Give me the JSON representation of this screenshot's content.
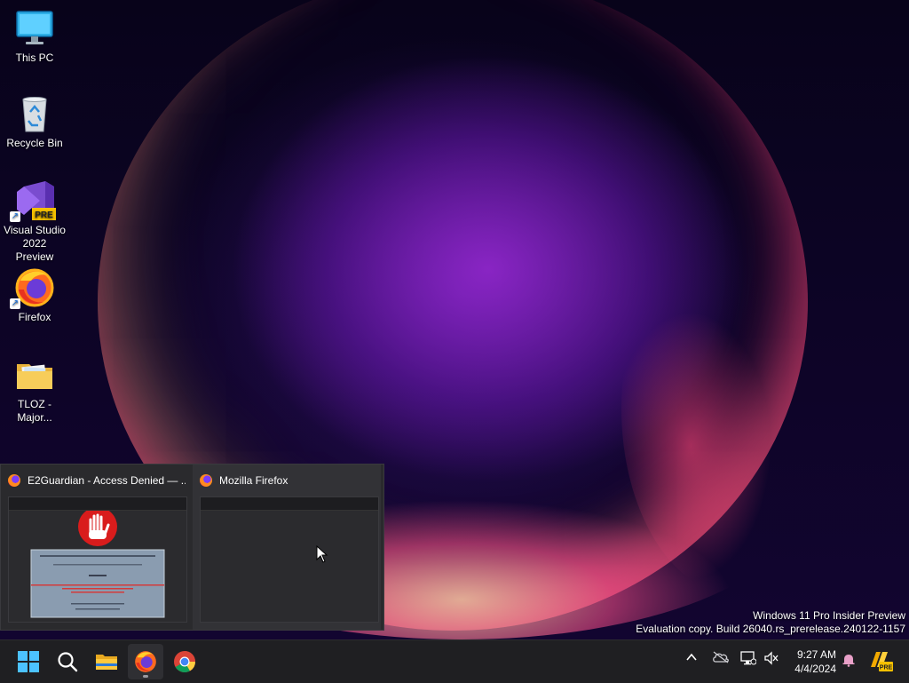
{
  "desktop": {
    "icons": [
      {
        "label": "This PC",
        "icon": "monitor-icon"
      },
      {
        "label": "Recycle Bin",
        "icon": "recycle-bin-icon"
      },
      {
        "label": "Visual Studio 2022 Preview",
        "icon": "visual-studio-icon",
        "badge": "PRE"
      },
      {
        "label": "Firefox",
        "icon": "firefox-icon"
      },
      {
        "label": "TLOZ - Major...",
        "icon": "folder-icon"
      }
    ]
  },
  "thumbnails": [
    {
      "title": "E2Guardian - Access Denied — ...",
      "icon": "firefox-icon"
    },
    {
      "title": "Mozilla Firefox",
      "icon": "firefox-icon"
    }
  ],
  "watermark": {
    "line1": "Windows 11 Pro Insider Preview",
    "line2": "Evaluation copy. Build 26040.rs_prerelease.240122-1157"
  },
  "taskbar": {
    "apps": [
      "start-icon",
      "search-icon",
      "file-explorer-icon",
      "firefox-icon",
      "chrome-icon"
    ],
    "tray": [
      "chevron-up-icon",
      "onedrive-icon",
      "network-icon",
      "volume-muted-icon"
    ],
    "time": "9:27 AM",
    "date": "4/4/2024",
    "badge": "PRE"
  },
  "colors": {
    "taskbar": "#1f1f22",
    "accent": "#0078d4",
    "popup": "#2a2a2d"
  }
}
